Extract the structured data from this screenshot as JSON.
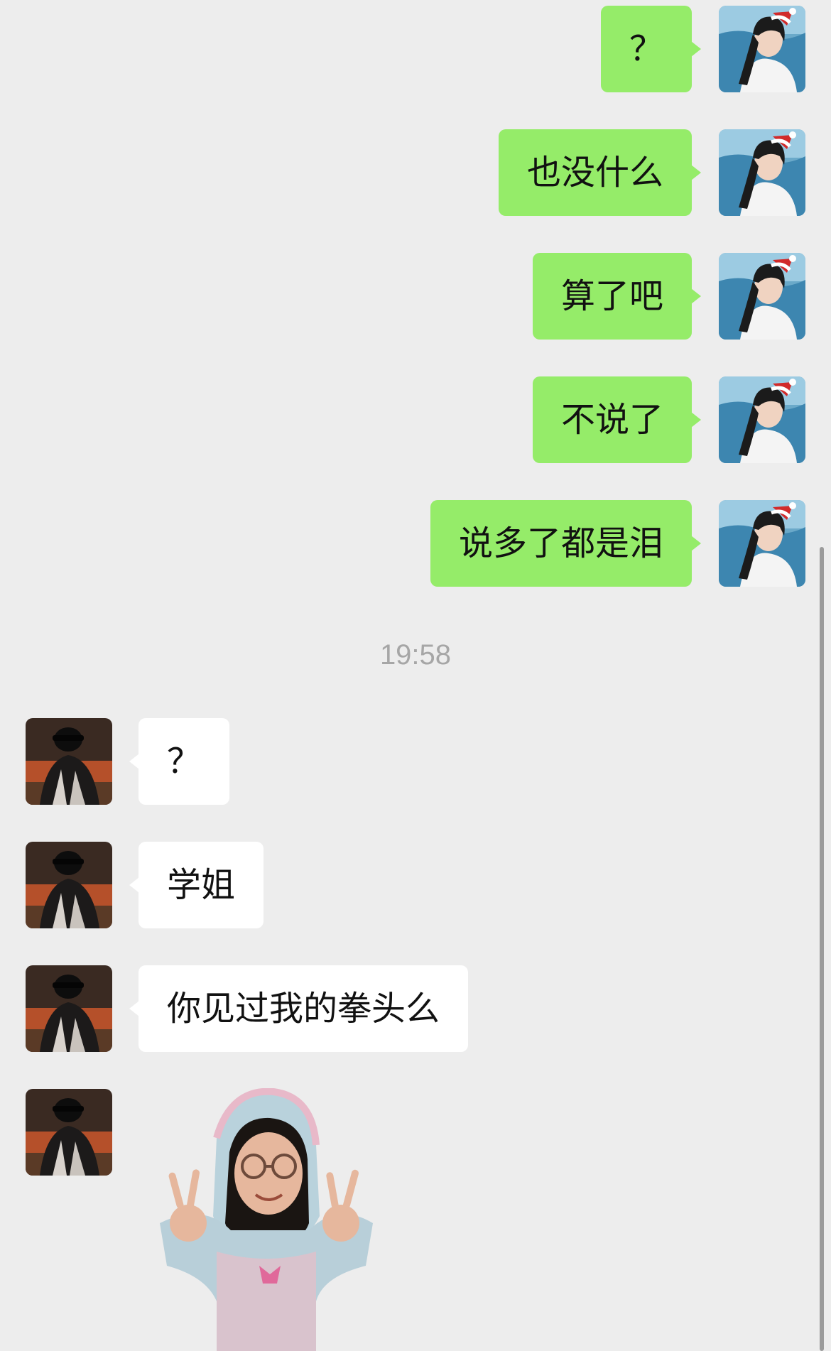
{
  "chat": {
    "outgoing_messages": [
      {
        "text": "？"
      },
      {
        "text": "也没什么"
      },
      {
        "text": "算了吧"
      },
      {
        "text": "不说了"
      },
      {
        "text": "说多了都是泪"
      }
    ],
    "timestamp": "19:58",
    "incoming_messages": [
      {
        "text": "？"
      },
      {
        "text": "学姐"
      },
      {
        "text": "你见过我的拳头么"
      }
    ],
    "incoming_sticker": {
      "type": "image",
      "description_icon": "sticker-girl-peace-sign"
    }
  },
  "colors": {
    "background": "#ededed",
    "outgoing_bubble": "#95ec69",
    "incoming_bubble": "#ffffff",
    "timestamp": "#a6a6a6"
  }
}
